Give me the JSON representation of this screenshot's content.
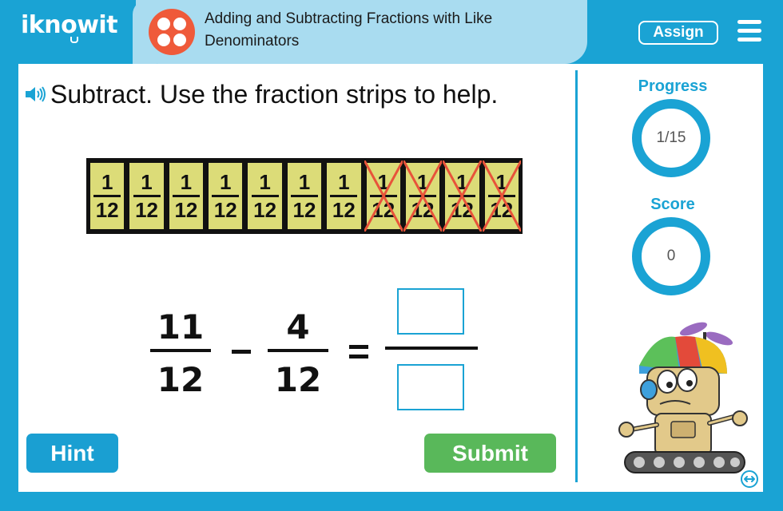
{
  "header": {
    "logo_text": "iknowit",
    "lesson_title": "Adding and Subtracting Fractions with Like Denominators",
    "assign_label": "Assign"
  },
  "question": {
    "text": "Subtract. Use the fraction strips to help."
  },
  "strip": {
    "cells": [
      {
        "numerator": "1",
        "denominator": "12",
        "crossed": false
      },
      {
        "numerator": "1",
        "denominator": "12",
        "crossed": false
      },
      {
        "numerator": "1",
        "denominator": "12",
        "crossed": false
      },
      {
        "numerator": "1",
        "denominator": "12",
        "crossed": false
      },
      {
        "numerator": "1",
        "denominator": "12",
        "crossed": false
      },
      {
        "numerator": "1",
        "denominator": "12",
        "crossed": false
      },
      {
        "numerator": "1",
        "denominator": "12",
        "crossed": false
      },
      {
        "numerator": "1",
        "denominator": "12",
        "crossed": true
      },
      {
        "numerator": "1",
        "denominator": "12",
        "crossed": true
      },
      {
        "numerator": "1",
        "denominator": "12",
        "crossed": true
      },
      {
        "numerator": "1",
        "denominator": "12",
        "crossed": true
      }
    ],
    "cell_color": "#dcdc78",
    "cross_color": "#e8533a"
  },
  "equation": {
    "first": {
      "numerator": "11",
      "denominator": "12"
    },
    "operator": "minus",
    "second": {
      "numerator": "4",
      "denominator": "12"
    },
    "answer": {
      "numerator": "",
      "denominator": ""
    }
  },
  "buttons": {
    "hint": "Hint",
    "submit": "Submit"
  },
  "sidebar": {
    "progress_label": "Progress",
    "progress_value": "1/15",
    "score_label": "Score",
    "score_value": "0"
  },
  "colors": {
    "brand_blue": "#1aa3d4",
    "tab_light_blue": "#a9dcf0",
    "dice_red": "#ef5a3a",
    "submit_green": "#59b85a"
  },
  "icons": [
    "dice-icon",
    "menu-icon",
    "speaker-icon",
    "expand-icon",
    "robot-mascot"
  ]
}
